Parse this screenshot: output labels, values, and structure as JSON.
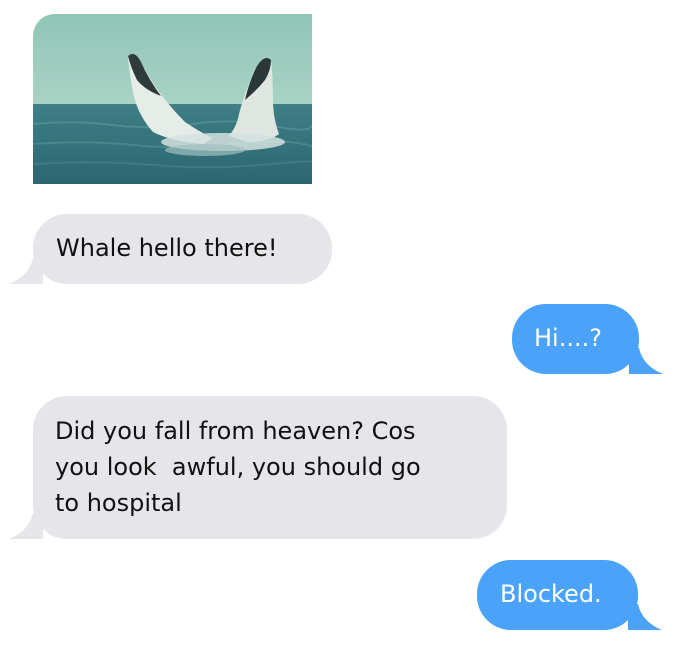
{
  "messages": [
    {
      "id": "photo",
      "direction": "received",
      "type": "image",
      "image_icon": "whale-breaching-photo"
    },
    {
      "id": "m1",
      "direction": "received",
      "text": "Whale hello there!"
    },
    {
      "id": "m2",
      "direction": "sent",
      "text": "Hi....?"
    },
    {
      "id": "m3",
      "direction": "received",
      "lines": [
        "Did you fall from heaven? Cos",
        "you look  awful, you should go",
        "to hospital"
      ]
    },
    {
      "id": "m4",
      "direction": "sent",
      "text": "Blocked."
    }
  ],
  "colors": {
    "received_bubble": "#e5e5ea",
    "sent_bubble": "#4aa3f8",
    "received_text": "#111111",
    "sent_text": "#ffffff"
  }
}
